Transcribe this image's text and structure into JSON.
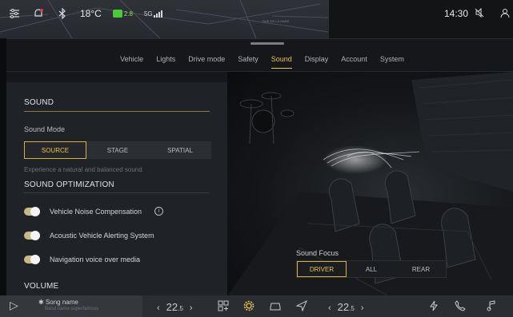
{
  "status": {
    "temperature": "18°C",
    "eco_label": "2.8",
    "network": "5G",
    "time": "14:30",
    "map_street": "RUE DE LA GARE"
  },
  "tabs": [
    {
      "label": "Vehicle",
      "active": false
    },
    {
      "label": "Lights",
      "active": false
    },
    {
      "label": "Drive mode",
      "active": false
    },
    {
      "label": "Safety",
      "active": false
    },
    {
      "label": "Sound",
      "active": true
    },
    {
      "label": "Display",
      "active": false
    },
    {
      "label": "Account",
      "active": false
    },
    {
      "label": "System",
      "active": false
    }
  ],
  "sound": {
    "title": "SOUND",
    "mode_label": "Sound Mode",
    "modes": [
      "SOURCE",
      "STAGE",
      "SPATIAL"
    ],
    "active_mode": "SOURCE",
    "mode_hint": "Experience a natural and balanced sound",
    "optimization_title": "SOUND OPTIMIZATION",
    "toggles": [
      {
        "label": "Vehicle Noise Compensation",
        "on": true,
        "info": "i"
      },
      {
        "label": "Acoustic Vehicle Alerting System",
        "on": true
      },
      {
        "label": "Navigation voice over media",
        "on": true
      }
    ],
    "volume_title": "VOLUME"
  },
  "focus": {
    "label": "Sound Focus",
    "options": [
      "DRIVER",
      "ALL",
      "REAR"
    ],
    "active": "DRIVER"
  },
  "dock": {
    "song_name": "Song name",
    "song_sub": "Band name superfamous",
    "temp_left": "22",
    "temp_right": "22",
    "temp_decimal": ".5"
  },
  "colors": {
    "accent": "#e8c547",
    "panel": "#1f2226",
    "toggle_on": "#c9b889"
  }
}
